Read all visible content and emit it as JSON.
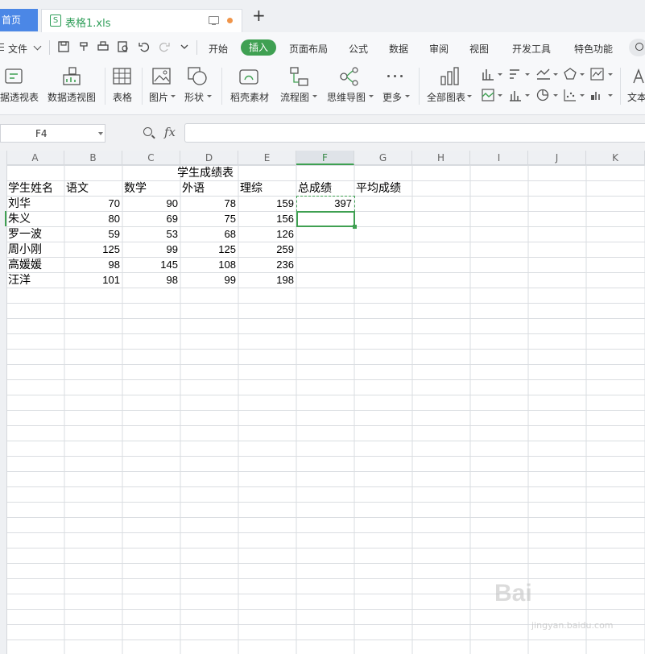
{
  "tabs": {
    "home": "首页",
    "document": {
      "icon_letter": "S",
      "title": "表格1.xls"
    },
    "new_tab": "+"
  },
  "menu": {
    "file": "文件",
    "items": [
      "开始",
      "插入",
      "页面布局",
      "公式",
      "数据",
      "审阅",
      "视图",
      "开发工具",
      "特色功能"
    ],
    "active": "插入"
  },
  "ribbon": {
    "pivot_table": "据透视表",
    "pivot_chart": "数据透视图",
    "table": "表格",
    "picture": "图片",
    "shape": "形状",
    "docer_assets": "稻壳素材",
    "flowchart": "流程图",
    "mindmap": "思维导图",
    "more": "更多",
    "all_charts": "全部图表",
    "textbox": "文本"
  },
  "formula_bar": {
    "cell_ref": "F4",
    "fx": "fx",
    "formula": ""
  },
  "sheet": {
    "columns": [
      "A",
      "B",
      "C",
      "D",
      "E",
      "F",
      "G",
      "H",
      "I",
      "J",
      "K"
    ],
    "active_column": "F",
    "title": "学生成绩表",
    "headers": [
      "学生姓名",
      "语文",
      "数学",
      "外语",
      "理综",
      "总成绩",
      "平均成绩"
    ],
    "rows": [
      {
        "name": "刘华",
        "scores": [
          "70",
          "90",
          "78",
          "159"
        ],
        "total": "397"
      },
      {
        "name": "朱义",
        "scores": [
          "80",
          "69",
          "75",
          "156"
        ],
        "total": ""
      },
      {
        "name": "罗一波",
        "scores": [
          "59",
          "53",
          "68",
          "126"
        ],
        "total": ""
      },
      {
        "name": "周小刚",
        "scores": [
          "125",
          "99",
          "125",
          "259"
        ],
        "total": ""
      },
      {
        "name": "高媛媛",
        "scores": [
          "98",
          "145",
          "108",
          "236"
        ],
        "total": ""
      },
      {
        "name": "汪洋",
        "scores": [
          "101",
          "98",
          "99",
          "198"
        ],
        "total": ""
      }
    ]
  },
  "watermark": {
    "brand": "Bai",
    "sub": "jingyan.baidu.com"
  },
  "colors": {
    "accent": "#3fa052",
    "home_tab": "#4b87e6"
  }
}
